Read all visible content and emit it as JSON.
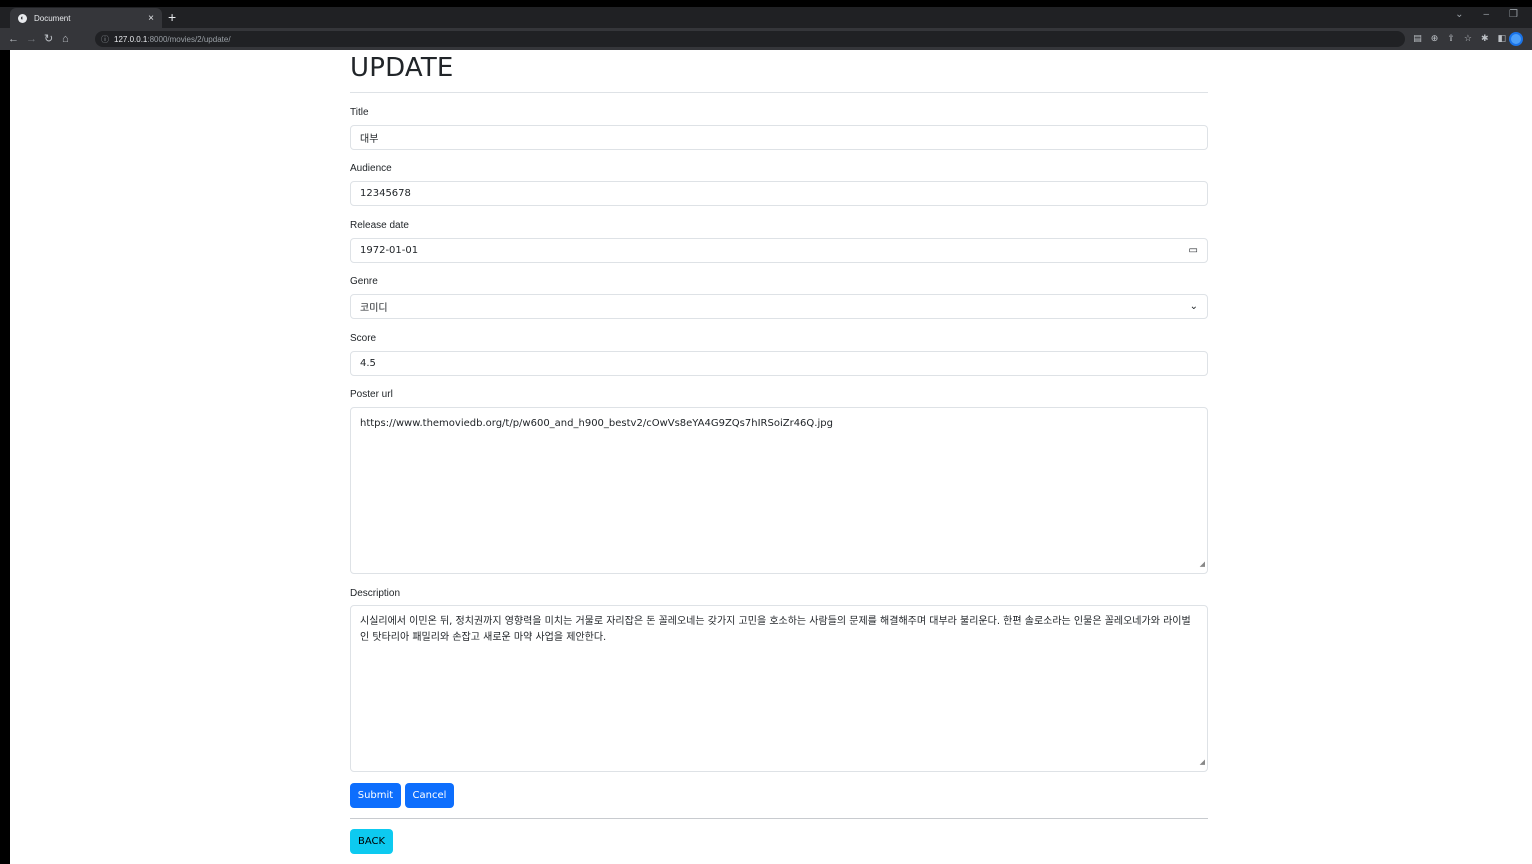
{
  "browser": {
    "tab_title": "Document",
    "tab_close": "×",
    "new_tab": "+",
    "url_host": "127.0.0.1",
    "url_path": ":8000/movies/2/update/"
  },
  "page": {
    "title": "UPDATE"
  },
  "form": {
    "title_label": "Title",
    "title_value": "대부",
    "audience_label": "Audience",
    "audience_value": "12345678",
    "release_label": "Release date",
    "release_value": "1972-01-01",
    "genre_label": "Genre",
    "genre_value": "코미디",
    "score_label": "Score",
    "score_value": "4.5",
    "poster_label": "Poster url",
    "poster_value": "https://www.themoviedb.org/t/p/w600_and_h900_bestv2/cOwVs8eYA4G9ZQs7hIRSoiZr46Q.jpg",
    "description_label": "Description",
    "description_value": "시실리에서 이민온 뒤, 정치권까지 영향력을 미치는 거물로 자리잡은 돈 꼴레오네는 갖가지 고민을 호소하는 사람들의 문제를 해결해주며 대부라 불리운다. 한편 솔로소라는 인물은 꼴레오네가와 라이벌인 탓타리아 패밀리와 손잡고 새로운 마약 사업을 제안한다."
  },
  "buttons": {
    "submit": "Submit",
    "cancel": "Cancel",
    "back": "BACK"
  },
  "colors": {
    "primary": "#0d6efd",
    "info": "#0dcaf0"
  }
}
